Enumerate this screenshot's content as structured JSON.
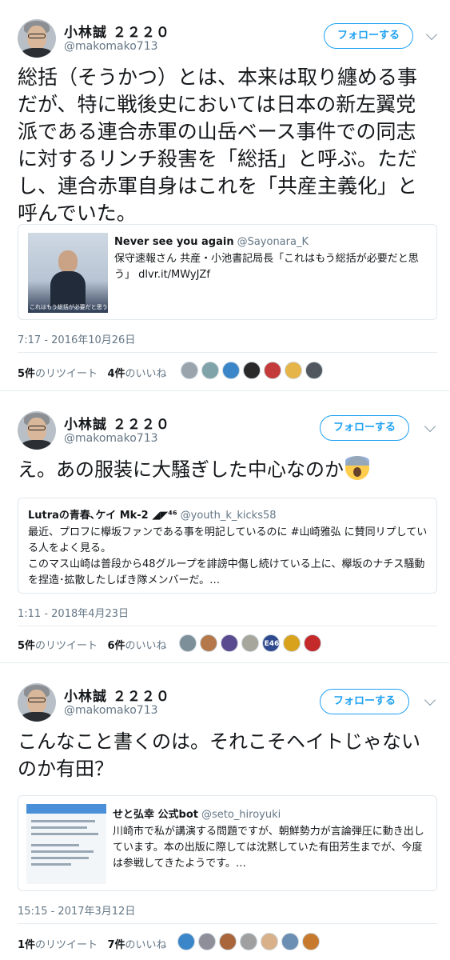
{
  "tweets": [
    {
      "name": "小林誠 ２２２０",
      "handle": "@makomako713",
      "follow_label": "フォローする",
      "text": "総括（そうかつ）とは、本来は取り纏める事だが、特に戦後史においては日本の新左翼党派である連合赤軍の山岳ベース事件での同志に対するリンチ殺害を「総括」と呼ぶ。ただし、連合赤軍自身はこれを「共産主義化」と呼んでいた。",
      "quote": {
        "name": "Never see you again",
        "handle": "@Sayonara_K",
        "text": "保守速報さん 共産・小池書記局長「これはもう総括が必要だと思う」 dlvr.it/MWyJZf",
        "thumb_caption": "これはもう総括が必要だと思う"
      },
      "timestamp": "7:17 - 2016年10月26日",
      "retweets_count": "5件",
      "retweets_label": "のリツイート",
      "likes_count": "4件",
      "likes_label": "のいいね",
      "likers": [
        "#9aa4ad",
        "#7fa3a8",
        "#3b86c9",
        "#2a2a2a",
        "#c43b3b",
        "#e6b54a",
        "#50575e"
      ]
    },
    {
      "name": "小林誠 ２２２０",
      "handle": "@makomako713",
      "follow_label": "フォローする",
      "text": "え。あの服装に大騒ぎした中心なのか",
      "quote": {
        "name": "Lutraの青春､ケイ Mk-2 ◢◤⁴⁶",
        "handle": "@youth_k_kicks58",
        "text": "最近、プロフに欅坂ファンである事を明記しているのに #山崎雅弘 に賛同リプしている人をよく見る。\nこのマス山崎は普段から48グループを誹謗中傷し続けている上に、欅坂のナチス騒動を捏造･拡散したしばき隊メンバーだ。…"
      },
      "timestamp": "1:11 - 2018年4月23日",
      "retweets_count": "5件",
      "retweets_label": "のリツイート",
      "likes_count": "6件",
      "likes_label": "のいいね",
      "likers": [
        "#7d8f98",
        "#b5784a",
        "#5a4a8f",
        "#a6a69c",
        "#2f4a8f",
        "#d9a21c",
        "#c42a2a"
      ],
      "liker_badge": "E46"
    },
    {
      "name": "小林誠 ２２２０",
      "handle": "@makomako713",
      "follow_label": "フォローする",
      "text": "こんなこと書くのは。それこそヘイトじゃないのか有田？",
      "quote": {
        "name": "せと弘幸 公式bot",
        "handle": "@seto_hiroyuki",
        "text": "川崎市で私が講演する問題ですが、朝鮮勢力が言論弾圧に動き出しています。本の出版に際しては沈黙していた有田芳生までが、今度は参戦してきたようです。…"
      },
      "timestamp": "15:15 - 2017年3月12日",
      "retweets_count": "1件",
      "retweets_label": "のリツイート",
      "likes_count": "7件",
      "likes_label": "のいいね",
      "likers": [
        "#3b86c9",
        "#8f8f9a",
        "#a8663a",
        "#a0a0a0",
        "#d8b08a",
        "#6b8fb3",
        "#c77a2e"
      ]
    }
  ]
}
